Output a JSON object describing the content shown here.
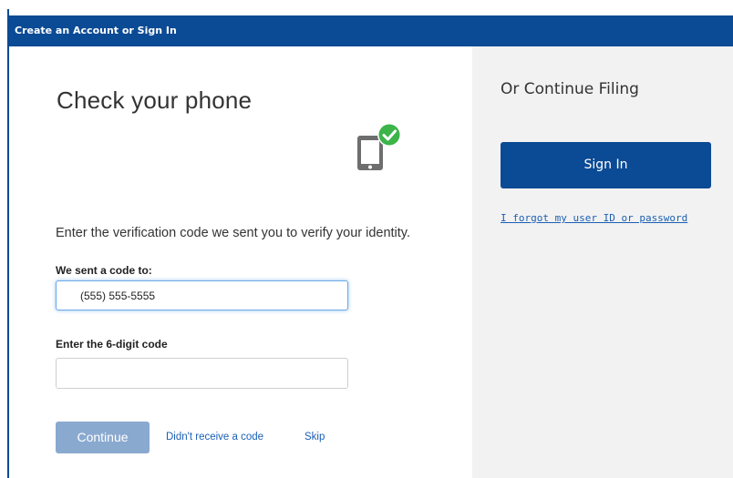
{
  "window": {
    "title": "Create an Account or Sign In"
  },
  "verify": {
    "heading": "Check your phone",
    "instruction": "Enter the verification code we sent you to verify your identity.",
    "sent_label": "We sent a code to:",
    "phone_value": "(555) 555-5555",
    "code_label": "Enter the 6-digit code",
    "code_value": "",
    "continue_label": "Continue",
    "no_code_link": "Didn't receive a code",
    "skip_link": "Skip",
    "icon": "phone-check-icon"
  },
  "signin": {
    "heading": "Or Continue Filing",
    "button_label": "Sign In",
    "forgot_link": "I forgot my user ID or password"
  },
  "colors": {
    "brand": "#0b4a94",
    "continue_disabled": "#8aa9cf",
    "check_green": "#3cb44a",
    "right_pane_bg": "#f2f2f2"
  }
}
